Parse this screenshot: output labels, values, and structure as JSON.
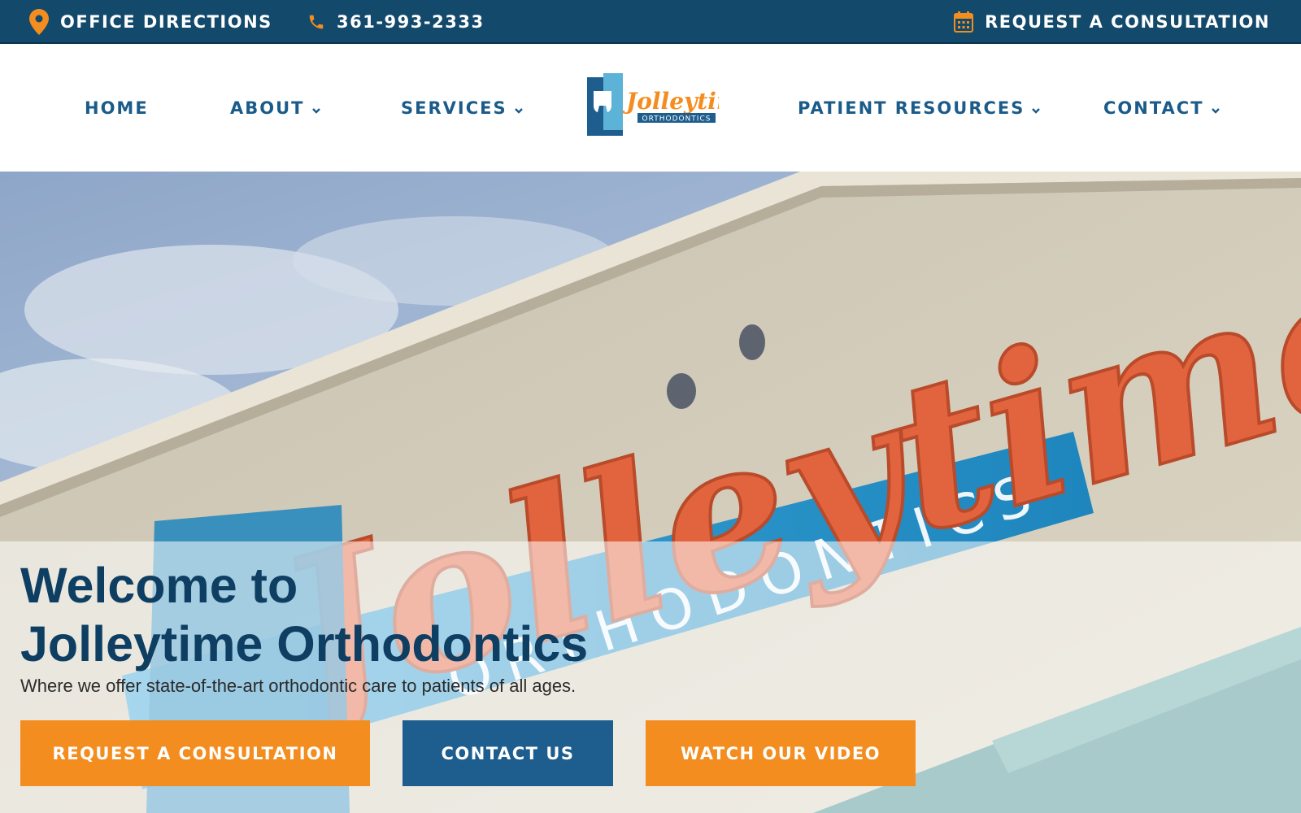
{
  "topbar": {
    "directions_label": "OFFICE DIRECTIONS",
    "phone_label": "361-993-2333",
    "consult_label": "REQUEST A CONSULTATION",
    "icon_color": "#f38d1f",
    "bg_color": "#13496b"
  },
  "nav": {
    "items": [
      {
        "label": "HOME",
        "has_dropdown": false
      },
      {
        "label": "ABOUT",
        "has_dropdown": true
      },
      {
        "label": "SERVICES",
        "has_dropdown": true
      },
      {
        "label": "PATIENT RESOURCES",
        "has_dropdown": true
      },
      {
        "label": "CONTACT",
        "has_dropdown": true
      }
    ],
    "text_color": "#1b5b8a"
  },
  "logo": {
    "wordmark": "Jolleytime",
    "subtitle": "ORTHODONTICS"
  },
  "hero": {
    "sign_word": "Jolleytime",
    "sign_sub": "ORTHODONTICS",
    "title_line1": "Welcome to",
    "title_line2": "Jolleytime Orthodontics",
    "subtitle": "Where we offer state-of-the-art orthodontic care to patients of all ages.",
    "buttons": {
      "consult": "REQUEST A CONSULTATION",
      "contact": "CONTACT US",
      "video": "WATCH OUR VIDEO"
    }
  },
  "colors": {
    "brand_orange": "#f38d1f",
    "brand_blue": "#1e5e8e",
    "dark_navy": "#0e3f63"
  }
}
